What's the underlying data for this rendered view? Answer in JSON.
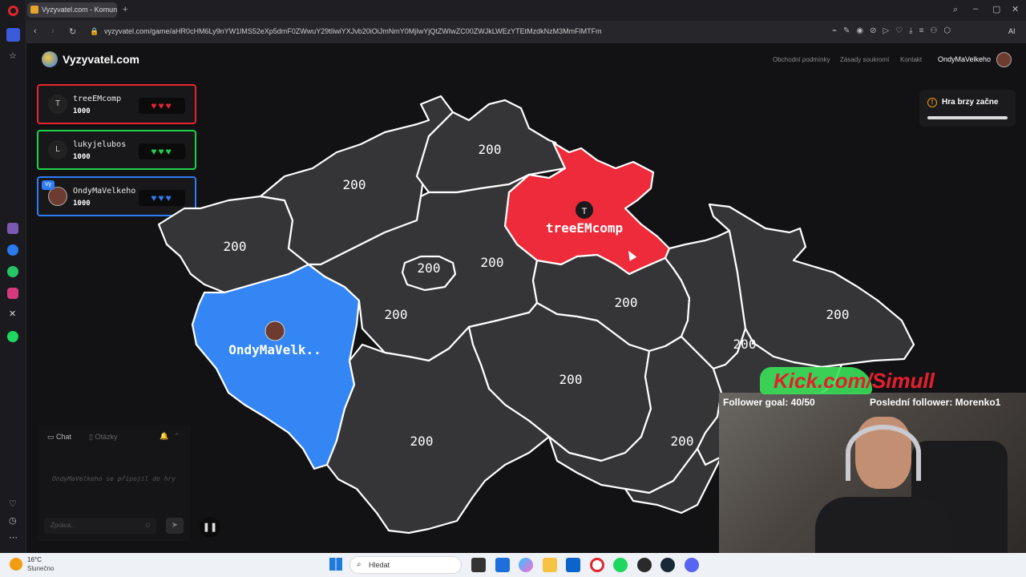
{
  "browser": {
    "tab_title": "Vyzyvatel.com - Komunit",
    "url": "vyzyvatel.com/game/aHR0cHM6Ly9nYW1lMS52eXp5dmF0ZWwuY29tIiwiYXJvb20iOiJmNmY0MjIwYjQtZWIwZC00ZWJkLWEzYTEtMzdkNzM3MmFlMTFm",
    "ai_label": "AI"
  },
  "site": {
    "logo": "Vyzyvatel.com",
    "nav": [
      "Obchodní podmínky",
      "Zásady soukromí",
      "Kontakt"
    ],
    "username": "OndyMaVelkeho"
  },
  "players": [
    {
      "initial": "T",
      "name": "treeEMcomp",
      "score": "1000",
      "hearts": "♥♥♥",
      "color": "#e8242f",
      "heart_color": "#e8242f"
    },
    {
      "initial": "L",
      "name": "lukyjelubos",
      "score": "1000",
      "hearts": "♥♥♥",
      "color": "#1fd14a",
      "heart_color": "#1fd14a"
    },
    {
      "initial": "",
      "name": "OndyMaVelkeho",
      "score": "1000",
      "hearts": "♥♥♥",
      "color": "#2e7cf6",
      "heart_color": "#2e7cf6",
      "badge": "Vy"
    }
  ],
  "game_status": {
    "text": "Hra brzy začne"
  },
  "map": {
    "regions": [
      {
        "id": "karlovarsky",
        "value": "200"
      },
      {
        "id": "ustecky",
        "value": "200"
      },
      {
        "id": "liberecky",
        "value": "200"
      },
      {
        "id": "kralovehradecky",
        "owner": "treeEMcomp",
        "initial": "T",
        "color": "#ee2b3a"
      },
      {
        "id": "praha",
        "value": "200"
      },
      {
        "id": "stredocesky",
        "value": "200"
      },
      {
        "id": "plzensky",
        "owner": "OndyMaVelk..",
        "color": "#3586f5"
      },
      {
        "id": "pardubicky",
        "value": "200"
      },
      {
        "id": "jihocesky",
        "value": "200"
      },
      {
        "id": "vysocina",
        "value": "200"
      },
      {
        "id": "jihomoravsky",
        "value": "200"
      },
      {
        "id": "olomoucky",
        "value": "200"
      },
      {
        "id": "moravskoslezsky",
        "value": "200"
      },
      {
        "id": "zlinsky",
        "value": "200"
      },
      {
        "id": "stredocesky2",
        "value": "200"
      }
    ]
  },
  "chat": {
    "tab_chat": "Chat",
    "tab_questions": "Otázky",
    "message": "OndyMaVelkeho se připojil do hry",
    "placeholder": "Zpráva..."
  },
  "stream": {
    "kick": "Kick.com/Simull",
    "follower_goal": "Follower goal: 40/50",
    "last_follower": "Poslední follower: Morenko1"
  },
  "taskbar": {
    "weather_temp": "16°C",
    "weather_text": "Slunečno",
    "search": "Hledat"
  }
}
